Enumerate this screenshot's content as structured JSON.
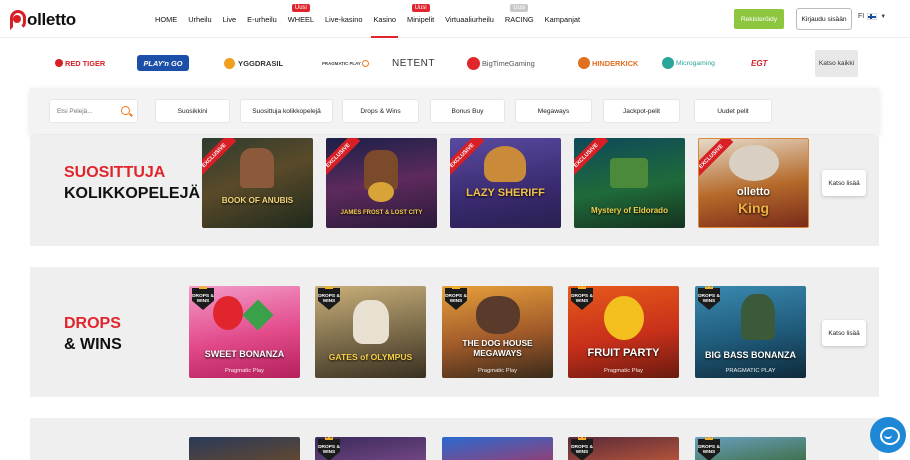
{
  "header": {
    "logo_text": "olletto",
    "nav": [
      {
        "label": "HOME",
        "badge": ""
      },
      {
        "label": "Urheilu",
        "badge": ""
      },
      {
        "label": "Live",
        "badge": ""
      },
      {
        "label": "E-urheilu",
        "badge": ""
      },
      {
        "label": "WHEEL",
        "badge": "Uusi"
      },
      {
        "label": "Live-kasino",
        "badge": ""
      },
      {
        "label": "Kasino",
        "badge": ""
      },
      {
        "label": "Minipelit",
        "badge": "Uusi"
      },
      {
        "label": "Virtuaaliurheilu",
        "badge": ""
      },
      {
        "label": "RACING",
        "badge": "Uusi"
      },
      {
        "label": "Kampanjat",
        "badge": ""
      }
    ],
    "active_nav": "Kasino",
    "register_label": "Rekisteröidy",
    "login_label": "Kirjaudu sisään",
    "language": "FI"
  },
  "providers": {
    "items": [
      "RED TIGER",
      "PLAY'n GO",
      "YGGDRASIL",
      "PRAGMATIC PLAY",
      "NETENT",
      "BigTimeGaming",
      "HINDERKICK",
      "Microgaming",
      "EGT"
    ],
    "view_all_label": "Katso kaikki"
  },
  "filters": {
    "search_placeholder": "Etsi Pelejä...",
    "chips": [
      "Suosikkini",
      "Suosittuja kolikkopelejä",
      "Drops & Wins",
      "Bonus Buy",
      "Megaways",
      "Jackpot-pelit",
      "Uudet pelit"
    ]
  },
  "sections": [
    {
      "title_red": "SUOSITTUJA",
      "title_dark": "KOLIKKOPELEJÄ",
      "see_more_label": "Katso lisää",
      "games": [
        {
          "name": "BOOK OF ANUBIS",
          "ribbon": "EXCLUSIVE",
          "studio": ""
        },
        {
          "name": "JAMES FROST & LOST CITY",
          "ribbon": "EXCLUSIVE",
          "studio": ""
        },
        {
          "name": "LAZY SHERIFF",
          "ribbon": "EXCLUSIVE",
          "studio": ""
        },
        {
          "name": "Mystery of Eldorado",
          "ribbon": "EXCLUSIVE",
          "studio": ""
        },
        {
          "name": "King",
          "ribbon": "EXCLUSIVE",
          "studio": ""
        }
      ]
    },
    {
      "title_red": "DROPS",
      "title_dark": "& WINS",
      "see_more_label": "Katso lisää",
      "badge_text": "DROPS & WINS",
      "games": [
        {
          "name": "SWEET BONANZA",
          "studio": "Pragmatic Play"
        },
        {
          "name": "GATES of OLYMPUS",
          "studio": ""
        },
        {
          "name": "THE DOG HOUSE MEGAWAYS",
          "studio": "Pragmatic Play"
        },
        {
          "name": "FRUIT PARTY",
          "studio": "Pragmatic Play"
        },
        {
          "name": "BIG BASS BONANZA",
          "studio": "PRAGMATIC PLAY"
        }
      ]
    }
  ],
  "colors": {
    "brand_red": "#e0262c",
    "register_green": "#8dc63f",
    "search_orange": "#f07b22",
    "chat_blue": "#1e88d6"
  },
  "icons": {
    "search": "search-icon",
    "chat": "chat-icon",
    "flag": "finland-flag-icon",
    "caret": "chevron-down-icon"
  }
}
